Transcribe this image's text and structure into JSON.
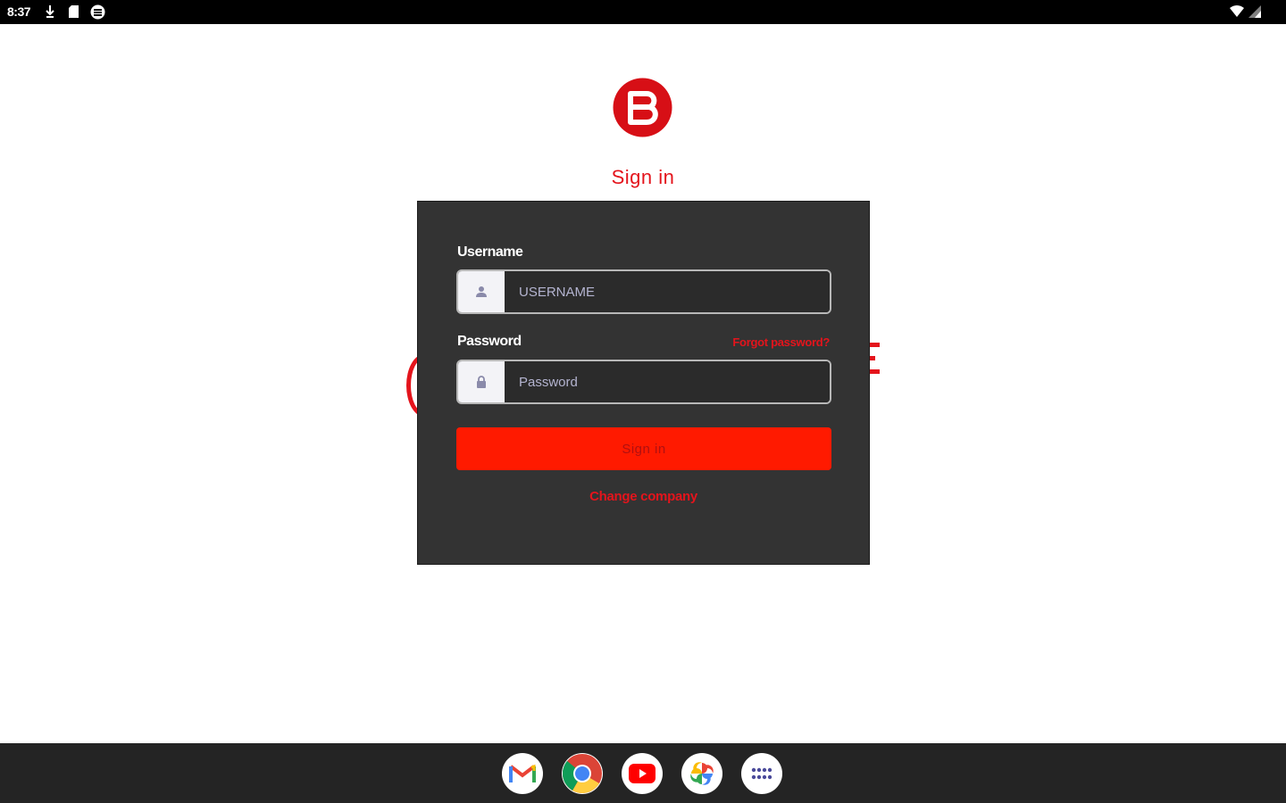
{
  "status_bar": {
    "time": "8:37"
  },
  "page": {
    "title": "Sign in",
    "brand_color": "#e4141c"
  },
  "form": {
    "username_label": "Username",
    "username_placeholder": "USERNAME",
    "password_label": "Password",
    "password_placeholder": "Password",
    "forgot_password": "Forgot password?",
    "submit_label": "Sign in",
    "change_company": "Change company"
  },
  "taskbar": {
    "apps": [
      "gmail-icon",
      "chrome-icon",
      "youtube-icon",
      "photos-icon",
      "app-launcher-icon"
    ]
  }
}
